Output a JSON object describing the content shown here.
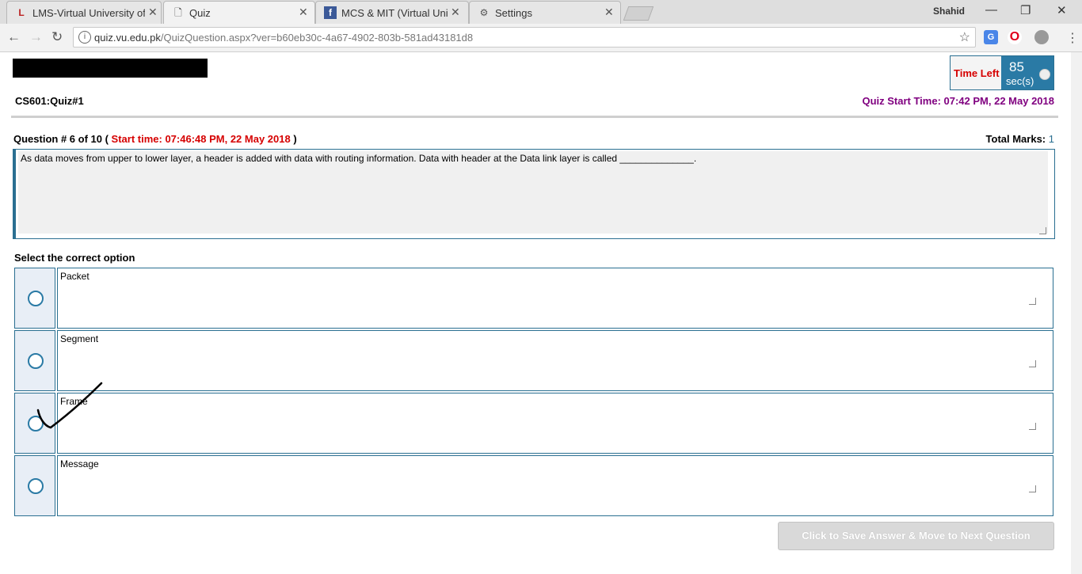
{
  "tabs": [
    {
      "icon": "lms-icon",
      "label": "LMS-Virtual University of",
      "active": false
    },
    {
      "icon": "page-icon",
      "label": "Quiz",
      "active": true
    },
    {
      "icon": "facebook-icon",
      "label": "MCS & MIT (Virtual Unive",
      "active": false
    },
    {
      "icon": "gear-icon",
      "label": "Settings",
      "active": false
    }
  ],
  "profile": "Shahid",
  "address": {
    "domain": "quiz.vu.edu.pk",
    "path": "/QuizQuestion.aspx?ver=b60eb30c-4a67-4902-803b-581ad43181d8"
  },
  "timer": {
    "label": "Time Left",
    "value": "85",
    "unit": "sec(s)"
  },
  "course": "CS601:Quiz#1",
  "quiz_start": "Quiz Start Time: 07:42 PM, 22 May 2018",
  "question": {
    "number_prefix": "Question # 6 of 10 (",
    "start_time": "Start time: 07:46:48 PM, 22 May 2018",
    "number_suffix": ")",
    "total_marks_label": "Total Marks:",
    "total_marks": "1",
    "text": "As data moves from upper to lower layer, a header is added with data with routing information. Data with header at the Data link layer is called ______________."
  },
  "select_label": "Select the correct option",
  "options": [
    "Packet",
    "Segment",
    "Frame",
    "Message"
  ],
  "save_button": "Click to Save Answer & Move to Next Question",
  "colors": {
    "accent": "#2a6f91",
    "time_red": "#d60000",
    "purple": "#800080"
  }
}
